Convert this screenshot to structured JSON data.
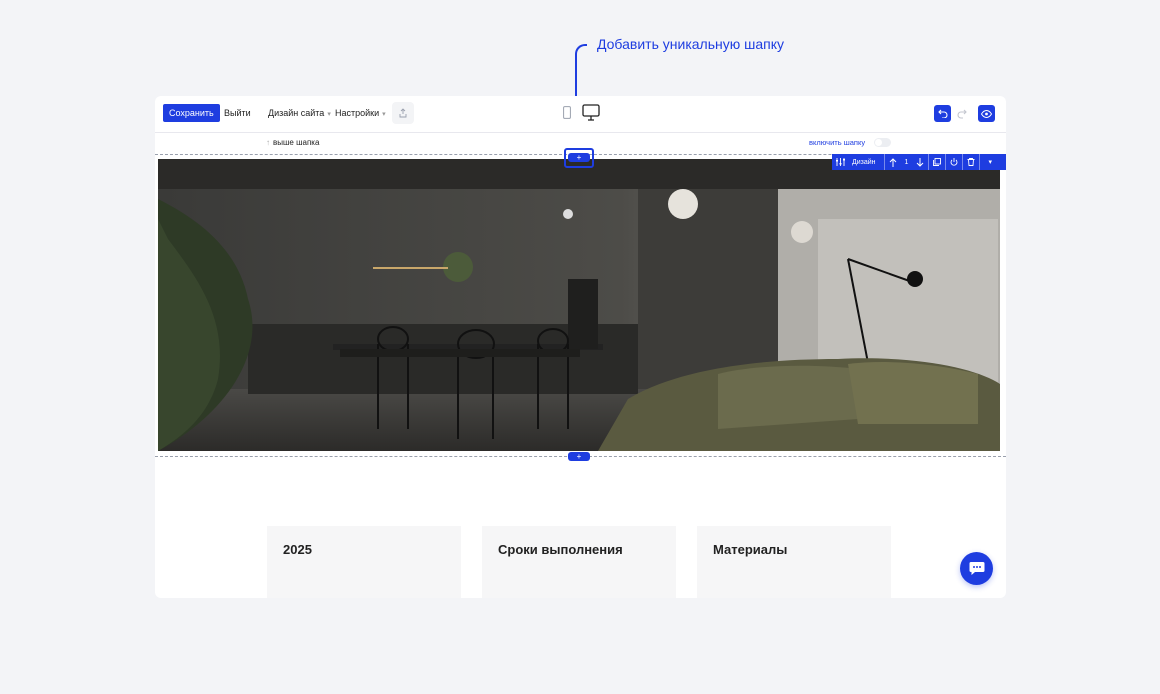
{
  "callout": {
    "text": "Добавить уникальную шапку"
  },
  "toolbar": {
    "save_label": "Сохранить",
    "exit_label": "Выйти",
    "design_menu_label": "Дизайн сайта",
    "settings_menu_label": "Настройки"
  },
  "subbar": {
    "above_label": "выше шапка",
    "enable_header_label": "включить шапку",
    "enable_header_on": false
  },
  "section_toolbar": {
    "design_label": "Дизайн",
    "position_number": "1"
  },
  "add_block": {
    "symbol": "+"
  },
  "cards": [
    {
      "title": "2025"
    },
    {
      "title": "Сроки выполнения"
    },
    {
      "title": "Материалы"
    }
  ],
  "colors": {
    "accent": "#1e3de0",
    "background": "#f3f4f7",
    "card": "#f6f6f7"
  },
  "icons": {
    "share": "upload-icon",
    "mobile": "mobile-device-icon",
    "desktop": "desktop-monitor-icon",
    "undo": "undo-icon",
    "redo": "redo-icon",
    "preview": "eye-icon",
    "chat": "chat-bubble-icon"
  }
}
